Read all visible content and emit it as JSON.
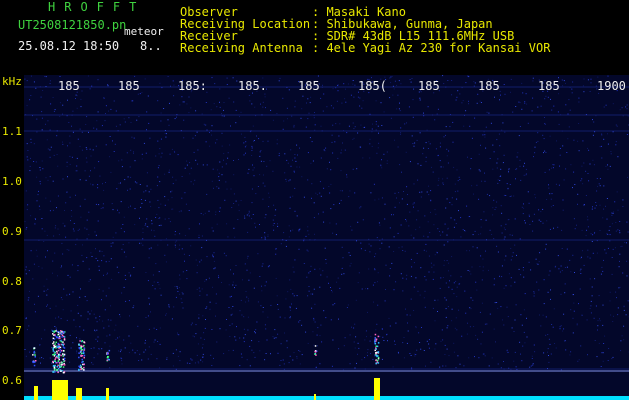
{
  "header": {
    "app_title": "HROFFT",
    "file_name": "UT2508121850.pn",
    "meteor_word": "meteor",
    "timestamp": "25.08.12 18:50",
    "count_value": "8..",
    "info": [
      {
        "key": "Observer",
        "value": ": Masaki Kano"
      },
      {
        "key": "Receiving Location",
        "value": ": Shibukawa, Gunma, Japan"
      },
      {
        "key": "Receiver",
        "value": ": SDR# 43dB L15 111.6MHz USB"
      },
      {
        "key": "Receiving Antenna",
        "value": ": 4ele Yagi Az 230 for Kansai VOR"
      }
    ]
  },
  "axes": {
    "y_unit": "kHz",
    "y_ticks": [
      "1.1",
      "1.0",
      "0.9",
      "0.8",
      "0.7",
      "0.6"
    ],
    "x_ticks": [
      "185",
      "185",
      "185:",
      "185.",
      "185",
      "185(",
      "185",
      "185",
      "185",
      "1900"
    ]
  },
  "colors": {
    "background": "#000000",
    "spectrogram_bg": "#03072a",
    "label_green": "#3fd23f",
    "label_yellow": "#e8e800",
    "signal_yellow": "#ffff00",
    "baseline_cyan": "#00e0ff"
  }
}
